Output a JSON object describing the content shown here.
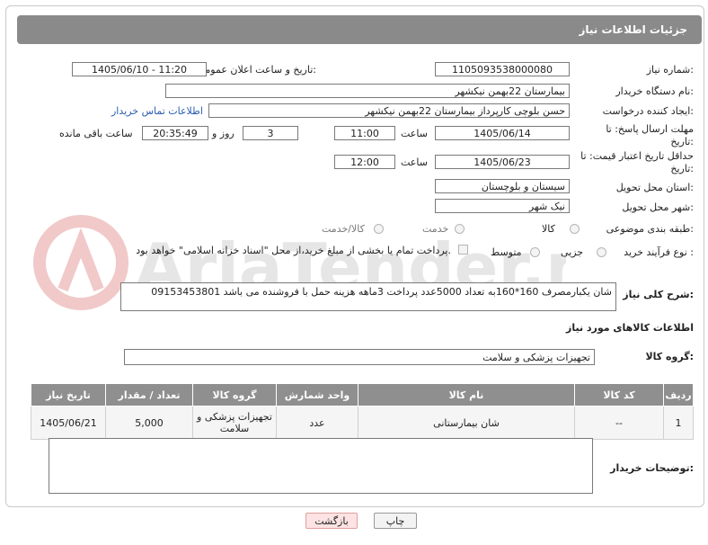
{
  "header": {
    "title": "جزئیات اطلاعات نیاز"
  },
  "fields": {
    "need_number_label": "شماره نیاز:",
    "need_number_value": "1105093538000080",
    "announce_label": "تاریخ و ساعت اعلان عمومی:",
    "announce_value": "1405/06/10 - 11:20",
    "buyer_org_label": "نام دستگاه خریدار:",
    "buyer_org_value": "بیمارستان 22بهمن نیکشهر",
    "creator_label": "ایجاد کننده درخواست:",
    "creator_value": "حسن بلوچی کارپرداز  بیمارستان 22بهمن نیکشهر",
    "contact_link": "اطلاعات تماس خریدار",
    "reply_deadline_label": "مهلت ارسال پاسخ: تا تاریخ:",
    "reply_date": "1405/06/14",
    "time_label": "ساعت",
    "reply_time": "11:00",
    "days_value": "3",
    "days_and_label": "روز و",
    "remaining_time": "20:35:49",
    "remaining_label": "ساعت باقی مانده",
    "price_validity_label": "حداقل تاریخ اعتبار قیمت: تا تاریخ:",
    "price_date": "1405/06/23",
    "price_time": "12:00",
    "delivery_province_label": "استان محل تحویل:",
    "delivery_province_value": "سیستان و بلوچستان",
    "delivery_city_label": "شهر محل تحویل:",
    "delivery_city_value": "نیک شهر",
    "category_label": "طبقه بندی موضوعی:",
    "category_options": [
      "کالا",
      "خدمت",
      "کالا/خدمت"
    ],
    "purchase_type_label": "نوع فرآیند خرید :",
    "purchase_options": [
      "جزیی",
      "متوسط"
    ],
    "payment_note": "پرداخت تمام یا بخشی از مبلغ خرید،از محل \"اسناد خزانه اسلامی\" خواهد بود."
  },
  "description": {
    "label": "شرح کلی نیاز:",
    "value": "شان یکبارمصرف 160*160به تعداد 5000عدد پرداخت 3ماهه هزینه حمل با فروشنده می باشد 09153453801"
  },
  "goods_info": {
    "title": "اطلاعات کالاهای مورد نیاز",
    "group_label": "گروه کالا:",
    "group_value": "تجهیزات پزشکی و سلامت"
  },
  "table": {
    "headers": [
      "ردیف",
      "کد کالا",
      "نام کالا",
      "واحد شمارش",
      "گروه کالا",
      "تعداد / مقدار",
      "تاریخ نیاز"
    ],
    "rows": [
      [
        "1",
        "--",
        "شان بیمارستانی",
        "عدد",
        "تجهیزات پزشکی و سلامت",
        "5,000",
        "1405/06/21"
      ]
    ]
  },
  "buyer_notes": {
    "label": "توضیحات خریدار:",
    "value": ""
  },
  "buttons": {
    "print": "چاپ",
    "back": "بازگشت"
  },
  "watermark": {
    "text": "AriaTender.neT"
  }
}
